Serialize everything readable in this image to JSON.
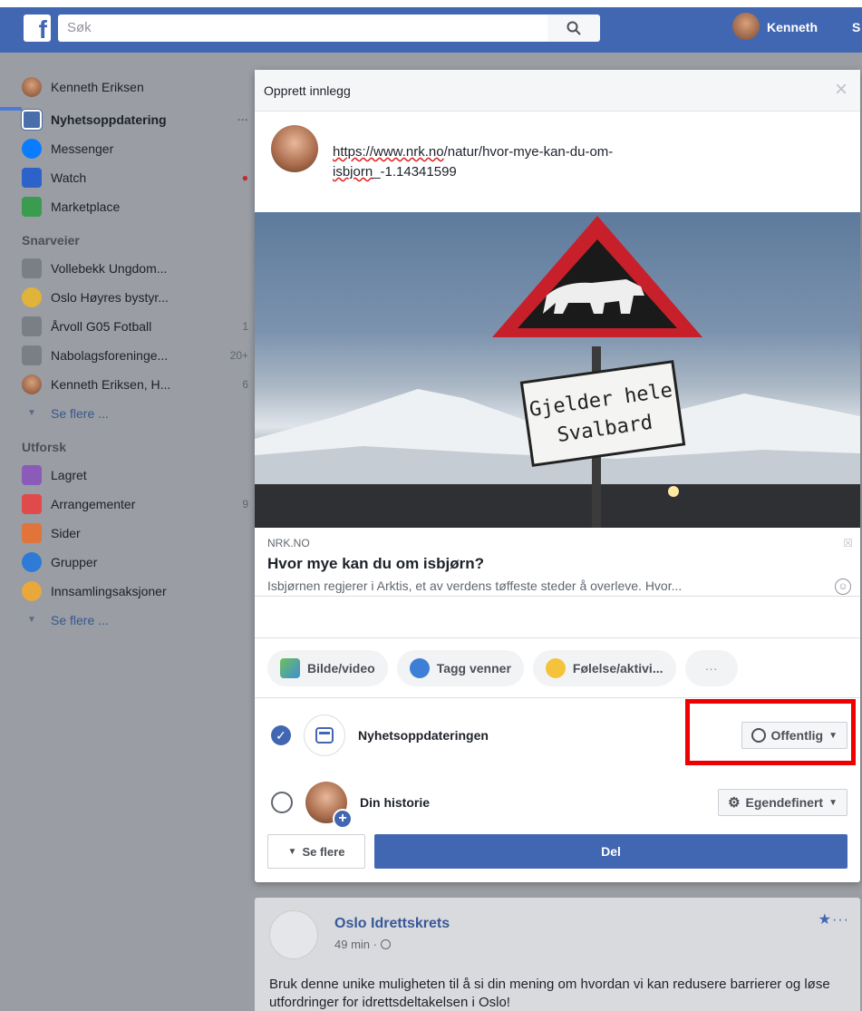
{
  "topbar": {
    "logo": "f",
    "search_placeholder": "Søk",
    "user": "Kenneth",
    "extra": "S"
  },
  "sidebar": {
    "profile": "Kenneth Eriksen",
    "items": [
      {
        "label": "Nyhetsoppdatering",
        "meta": "···"
      },
      {
        "label": "Messenger"
      },
      {
        "label": "Watch",
        "meta": "●"
      },
      {
        "label": "Marketplace"
      }
    ],
    "shortcuts_head": "Snarveier",
    "shortcuts": [
      {
        "label": "Vollebekk Ungdom...",
        "count": ""
      },
      {
        "label": "Oslo Høyres bystyr...",
        "count": ""
      },
      {
        "label": "Årvoll G05 Fotball",
        "count": "1"
      },
      {
        "label": "Nabolagsforeninge...",
        "count": "20+"
      },
      {
        "label": "Kenneth Eriksen, H...",
        "count": "6"
      }
    ],
    "see_more_1": "Se flere ...",
    "explore_head": "Utforsk",
    "explore": [
      {
        "label": "Lagret",
        "count": ""
      },
      {
        "label": "Arrangementer",
        "count": "9"
      },
      {
        "label": "Sider",
        "count": ""
      },
      {
        "label": "Grupper",
        "count": ""
      },
      {
        "label": "Innsamlingsaksjoner",
        "count": ""
      }
    ],
    "see_more_2": "Se flere ..."
  },
  "modal": {
    "title": "Opprett innlegg",
    "close": "×",
    "url_line1_a": "https://www.nrk.no",
    "url_line1_b": "/natur/hvor-mye-kan-du-om-",
    "url_line2_a": "isbjorn",
    "url_line2_b": "_-1.14341599",
    "sign_text_1": "Gjelder hele",
    "sign_text_2": "Svalbard",
    "preview": {
      "site": "NRK.NO",
      "title": "Hvor mye kan du om isbjørn?",
      "desc": "Isbjørnen regjerer i Arktis, et av verdens tøffeste steder å overleve. Hvor...",
      "close": "☒",
      "smile": "☺"
    },
    "actions": [
      {
        "label": "Bilde/video"
      },
      {
        "label": "Tagg venner"
      },
      {
        "label": "Følelse/aktivi..."
      },
      {
        "label": "···"
      }
    ],
    "targets": [
      {
        "label": "Nyhetsoppdateringen",
        "privacy": "Offentlig",
        "checked": true
      },
      {
        "label": "Din historie",
        "privacy": "Egendefinert",
        "checked": false
      }
    ],
    "see_more": "Se flere",
    "share": "Del"
  },
  "post": {
    "name": "Oslo Idrettskrets",
    "time": "49 min ·",
    "star": "★···",
    "text": "Bruk denne unike muligheten til å si din mening om hvordan vi kan redusere barrierer og løse utfordringer for idrettsdeltakelsen i Oslo!"
  },
  "colors": {
    "brand": "#4267b2",
    "highlight": "#ee0000"
  }
}
